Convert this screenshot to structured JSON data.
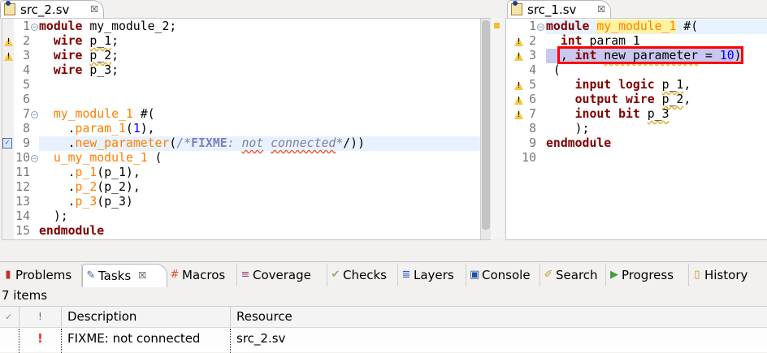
{
  "left_editor": {
    "tab_title": "src_2.sv",
    "close_icon": "close-icon",
    "lines": [
      [
        [
          "module",
          "kw"
        ],
        [
          " my_module_2;",
          ""
        ]
      ],
      [
        [
          "  ",
          ""
        ],
        [
          "wire",
          "kw"
        ],
        [
          " ",
          ""
        ],
        [
          "p_1",
          "sq"
        ],
        [
          ";",
          ""
        ]
      ],
      [
        [
          "  ",
          ""
        ],
        [
          "wire",
          "kw"
        ],
        [
          " ",
          ""
        ],
        [
          "p_2",
          "sq"
        ],
        [
          ";",
          ""
        ]
      ],
      [
        [
          "  ",
          ""
        ],
        [
          "wire",
          "kw"
        ],
        [
          " p_3;",
          ""
        ]
      ],
      [],
      [],
      [
        [
          "  ",
          ""
        ],
        [
          "my_module_1",
          "id"
        ],
        [
          " #(",
          ""
        ]
      ],
      [
        [
          "    .",
          ""
        ],
        [
          "param_1",
          "id"
        ],
        [
          "(",
          ""
        ],
        [
          "1",
          "num"
        ],
        [
          "),",
          ""
        ]
      ],
      [
        [
          "    .",
          ""
        ],
        [
          "new_parameter",
          "id"
        ],
        [
          "(",
          ""
        ],
        [
          "/*",
          "cm"
        ],
        [
          "FIXME",
          "fx"
        ],
        [
          ": ",
          "cm"
        ],
        [
          "not",
          "cm sqr"
        ],
        [
          " ",
          "cm"
        ],
        [
          "connected",
          "cm sqr"
        ],
        [
          "*",
          "cm"
        ],
        [
          "/))",
          ""
        ]
      ],
      [
        [
          "  ",
          ""
        ],
        [
          "u_my_module_1",
          "id"
        ],
        [
          " (",
          ""
        ]
      ],
      [
        [
          "    .",
          ""
        ],
        [
          "p_1",
          "id"
        ],
        [
          "(p_1),",
          ""
        ]
      ],
      [
        [
          "    .",
          ""
        ],
        [
          "p_2",
          "id"
        ],
        [
          "(p_2),",
          ""
        ]
      ],
      [
        [
          "    .",
          ""
        ],
        [
          "p_3",
          "id"
        ],
        [
          "(p_3)",
          ""
        ]
      ],
      [
        [
          "  );",
          ""
        ]
      ],
      [
        [
          "endmodule",
          "kw"
        ]
      ]
    ],
    "warning_lines": [
      2,
      3
    ],
    "fold_lines": [
      1,
      7,
      10
    ],
    "task_line": 9,
    "current_line": 9
  },
  "right_editor": {
    "tab_title": "src_1.sv",
    "close_icon": "close-icon",
    "lines": [
      [
        [
          "module",
          "kw"
        ],
        [
          " ",
          ""
        ],
        [
          "my_module_1",
          "id hl"
        ],
        [
          " #(",
          ""
        ]
      ],
      [
        [
          "  ",
          ""
        ],
        [
          "int",
          "kw"
        ],
        [
          " param_1",
          ""
        ]
      ],
      [
        [
          "  , ",
          ""
        ],
        [
          "int",
          "kw"
        ],
        [
          " ",
          ""
        ],
        [
          "new_parameter",
          "sq"
        ],
        [
          " = ",
          ""
        ],
        [
          "10",
          "num"
        ],
        [
          ")",
          ""
        ]
      ],
      [
        [
          " (",
          ""
        ]
      ],
      [
        [
          "    ",
          ""
        ],
        [
          "input",
          "kw"
        ],
        [
          " ",
          ""
        ],
        [
          "logic",
          "kw"
        ],
        [
          " ",
          ""
        ],
        [
          "p_1",
          "sq"
        ],
        [
          ",",
          ""
        ]
      ],
      [
        [
          "    ",
          ""
        ],
        [
          "output",
          "kw"
        ],
        [
          " ",
          ""
        ],
        [
          "wire",
          "kw"
        ],
        [
          " ",
          ""
        ],
        [
          "p_2",
          "sq"
        ],
        [
          ",",
          ""
        ]
      ],
      [
        [
          "    ",
          ""
        ],
        [
          "inout",
          "kw"
        ],
        [
          " ",
          ""
        ],
        [
          "bit",
          "kw"
        ],
        [
          " ",
          ""
        ],
        [
          "p_3",
          "sq"
        ]
      ],
      [
        [
          "    );",
          ""
        ]
      ],
      [
        [
          "endmodule",
          "kw"
        ]
      ],
      []
    ],
    "warning_lines": [
      2,
      3,
      5,
      6,
      7
    ],
    "fold_lines": [
      1
    ],
    "selected_line": 3,
    "current_line": 1
  },
  "bottom_tabs": [
    {
      "label": "Problems",
      "icon": "problems-icon",
      "glyph": "▮",
      "color": "#c03030"
    },
    {
      "label": "Tasks",
      "icon": "tasks-icon",
      "glyph": "✎",
      "color": "#4060a0",
      "active": true
    },
    {
      "label": "Macros",
      "icon": "hash-icon",
      "glyph": "#",
      "color": "#e05020"
    },
    {
      "label": "Coverage",
      "icon": "coverage-icon",
      "glyph": "≡",
      "color": "#a04080"
    },
    {
      "label": "Checks",
      "icon": "check-icon",
      "glyph": "✔",
      "color": "#90b060"
    },
    {
      "label": "Layers",
      "icon": "layers-icon",
      "glyph": "≣",
      "color": "#3060c0"
    },
    {
      "label": "Console",
      "icon": "console-icon",
      "glyph": "▣",
      "color": "#2050a0"
    },
    {
      "label": "Search",
      "icon": "search-icon",
      "glyph": "✐",
      "color": "#c0a040"
    },
    {
      "label": "Progress",
      "icon": "progress-icon",
      "glyph": "▶",
      "color": "#40a040"
    },
    {
      "label": "History",
      "icon": "history-icon",
      "glyph": "▯",
      "color": "#c09020"
    },
    {
      "label": "",
      "icon": "p-icon",
      "glyph": "p",
      "color": "#208070"
    }
  ],
  "tasks": {
    "count": "7 items",
    "columns": [
      "✓",
      "!",
      "Description",
      "Resource"
    ],
    "rows": [
      {
        "done": "",
        "priority": "!",
        "description": "FIXME: not connected",
        "resource": "src_2.sv"
      }
    ]
  },
  "colors": {
    "selection_box": "#ff0000",
    "selection_bg": "#c8c8f0",
    "current_line": "#e8f2fe",
    "keyword": "#7f0000",
    "identifier": "#ff7f00"
  }
}
